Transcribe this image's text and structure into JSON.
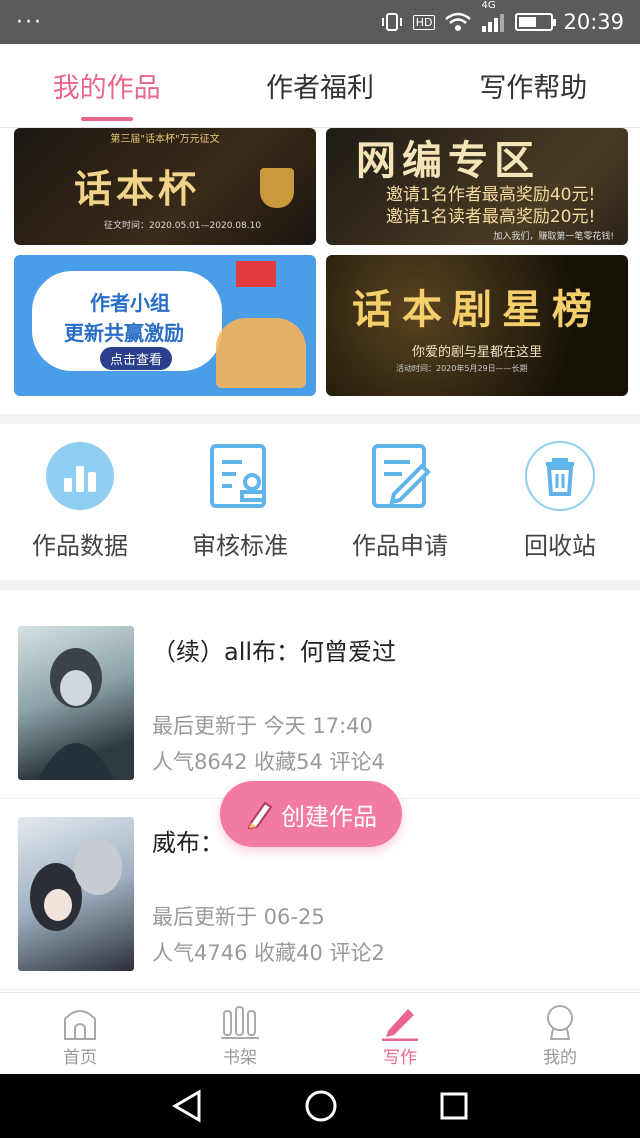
{
  "status_bar": {
    "dots": "···",
    "hd": "HD",
    "network": "4G",
    "battery_level": 0.55,
    "time": "20:39"
  },
  "tabs": [
    {
      "label": "我的作品",
      "active": true
    },
    {
      "label": "作者福利",
      "active": false
    },
    {
      "label": "写作帮助",
      "active": false
    }
  ],
  "banners": {
    "b1": {
      "top": "第三届\"话本杯\"万元征文",
      "title": "话本杯",
      "date": "征文时间：2020.05.01—2020.08.10"
    },
    "b2": {
      "title": "网编专区",
      "line1": "邀请1名作者最高奖励40元!",
      "line2": "邀请1名读者最高奖励20元!",
      "foot": "加入我们，赚取第一笔零花钱!"
    },
    "b3": {
      "line1": "作者小组",
      "line2": "更新共赢激励",
      "button": "点击查看"
    },
    "b4": {
      "title": "话本剧星榜",
      "subtitle": "你爱的剧与星都在这里",
      "foot": "活动时间：2020年5月29日——长期"
    }
  },
  "actions": [
    {
      "label": "作品数据",
      "icon": "bar-chart-icon"
    },
    {
      "label": "审核标准",
      "icon": "review-standard-icon"
    },
    {
      "label": "作品申请",
      "icon": "edit-document-icon"
    },
    {
      "label": "回收站",
      "icon": "trash-icon"
    }
  ],
  "works": [
    {
      "title": "（续）all布：何曾爱过",
      "updated": "最后更新于 今天 17:40",
      "stats": "人气8642 收藏54 评论4"
    },
    {
      "title": "威布：",
      "updated": "最后更新于 06-25",
      "stats": "人气4746 收藏40 评论2"
    }
  ],
  "fab": {
    "label": "创建作品",
    "icon": "pencil-icon"
  },
  "bottom_nav": [
    {
      "label": "首页",
      "icon": "home-icon",
      "active": false
    },
    {
      "label": "书架",
      "icon": "bookshelf-icon",
      "active": false
    },
    {
      "label": "写作",
      "icon": "pen-icon",
      "active": true
    },
    {
      "label": "我的",
      "icon": "profile-icon",
      "active": false
    }
  ],
  "colors": {
    "accent": "#e8668c",
    "fab": "#f37aa1",
    "icon_blue": "#5fb4ea"
  }
}
